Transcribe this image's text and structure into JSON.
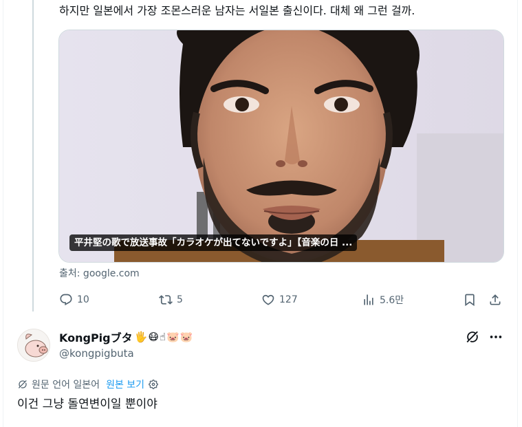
{
  "post": {
    "text": "하지만 일본에서 가장 조몬스러운 남자는 서일본 출신이다. 대체 왜 그런 걸까.",
    "media_caption": "平井堅の歌で放送事故「カラオケが出てないですよ」【音楽の日 ...",
    "media_source": "출처: google.com",
    "stats": {
      "replies": "10",
      "reposts": "5",
      "likes": "127",
      "views": "5.6만"
    }
  },
  "reply": {
    "display_name": "KongPigブタ",
    "name_emojis": [
      "🖐",
      "😷",
      "☝",
      "🐷",
      "🐷"
    ],
    "handle": "@kongpigbuta",
    "translation_note": "원문 언어 일본어",
    "show_original_label": "원본 보기",
    "text": "이건 그냥 돌연변이일 뿐이야"
  },
  "icons": {
    "reply": "reply-icon",
    "repost": "repost-icon",
    "like": "heart-icon",
    "views": "analytics-icon",
    "bookmark": "bookmark-icon",
    "share": "share-icon",
    "grok": "grok-icon",
    "more": "more-icon",
    "translate": "translate-icon",
    "settings": "gear-icon"
  },
  "colors": {
    "link": "#1d9bf0",
    "muted": "#536471",
    "text": "#0f1419"
  }
}
